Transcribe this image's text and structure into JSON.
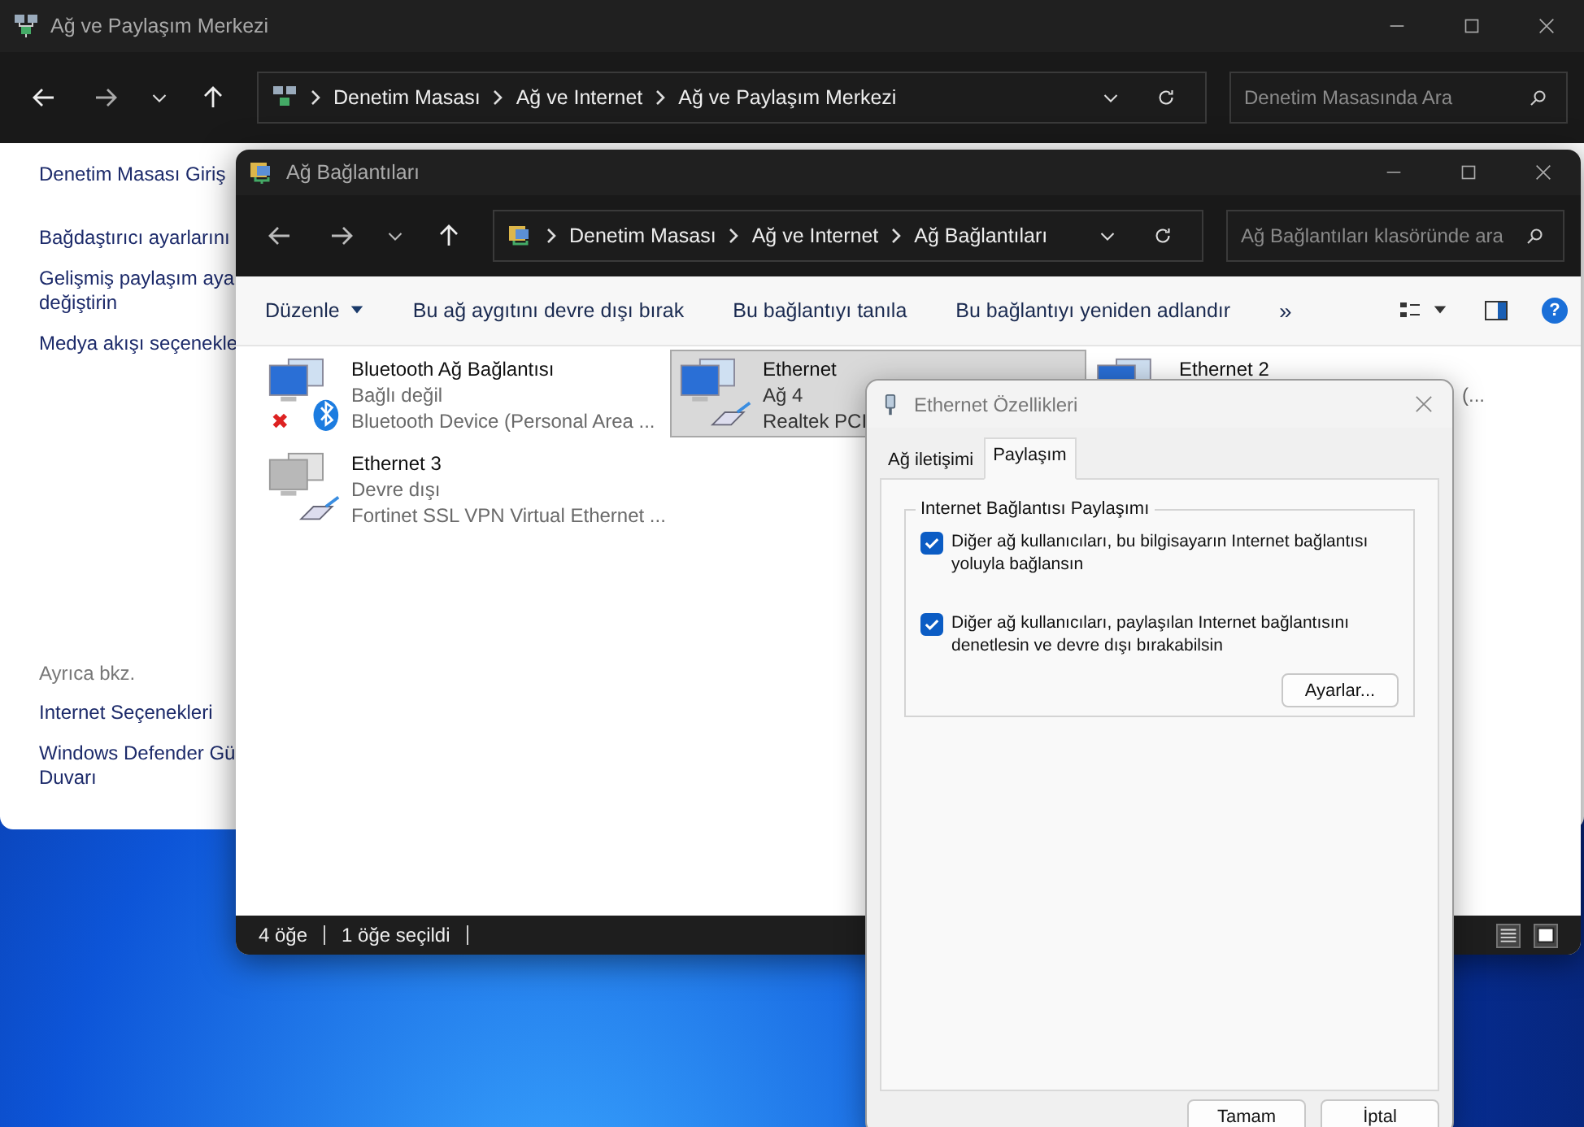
{
  "back_window": {
    "title": "Ağ ve Paylaşım Merkezi",
    "breadcrumb": [
      "Denetim Masası",
      "Ağ ve Internet",
      "Ağ ve Paylaşım Merkezi"
    ],
    "search": {
      "placeholder": "Denetim Masasında Ara"
    },
    "sidebar": {
      "links": [
        [
          "Denetim Masası Giriş"
        ],
        [
          "Bağdaştırıcı ayarlarını"
        ],
        [
          "Gelişmiş paylaşım aya",
          "değiştirin"
        ],
        [
          "Medya akışı seçenekle"
        ]
      ],
      "see_also_title": "Ayrıca bkz.",
      "see_also": [
        [
          "Internet Seçenekleri"
        ],
        [
          "Windows Defender Gü",
          "Duvarı"
        ]
      ]
    }
  },
  "front_window": {
    "title": "Ağ Bağlantıları",
    "breadcrumb": [
      "Denetim Masası",
      "Ağ ve Internet",
      "Ağ Bağlantıları"
    ],
    "search": {
      "placeholder": "Ağ Bağlantıları klasöründe ara"
    },
    "toolbar": {
      "organize": "Düzenle",
      "actions": [
        "Bu ağ aygıtını devre dışı bırak",
        "Bu bağlantıyı tanıla",
        "Bu bağlantıyı yeniden adlandır"
      ],
      "more": "»",
      "help": "?"
    },
    "items": [
      {
        "name": "Bluetooth Ağ Bağlantısı",
        "status": "Bağlı değil",
        "device": "Bluetooth Device (Personal Area ...",
        "kind": "bluetooth",
        "selected": false
      },
      {
        "name": "Ethernet",
        "status": "Ağ 4",
        "device": "Realtek PCI",
        "kind": "ethernet",
        "selected": true
      },
      {
        "name": "Ethernet 2",
        "device": "(...",
        "kind": "ethernet",
        "selected": false
      },
      {
        "name": "Ethernet 3",
        "status": "Devre dışı",
        "device": "Fortinet SSL VPN Virtual Ethernet ...",
        "kind": "disabled",
        "selected": false
      }
    ],
    "status_bar": [
      "4 öğe",
      "1 öğe seçildi"
    ]
  },
  "dialog": {
    "title": "Ethernet Özellikleri",
    "tabs": [
      {
        "label": "Ağ iletişimi",
        "selected": false
      },
      {
        "label": "Paylaşım",
        "selected": true
      }
    ],
    "group_title": "Internet Bağlantısı Paylaşımı",
    "options": [
      {
        "lines": [
          "Diğer ağ kullanıcıları, bu bilgisayarın Internet bağlantısı",
          "yoluyla bağlansın"
        ],
        "checked": true
      },
      {
        "lines": [
          "Diğer ağ kullanıcıları, paylaşılan Internet bağlantısını",
          "denetlesin ve devre dışı bırakabilsin"
        ],
        "checked": true
      }
    ],
    "settings_button": "Ayarlar...",
    "buttons": [
      "Tamam",
      "İptal"
    ]
  }
}
